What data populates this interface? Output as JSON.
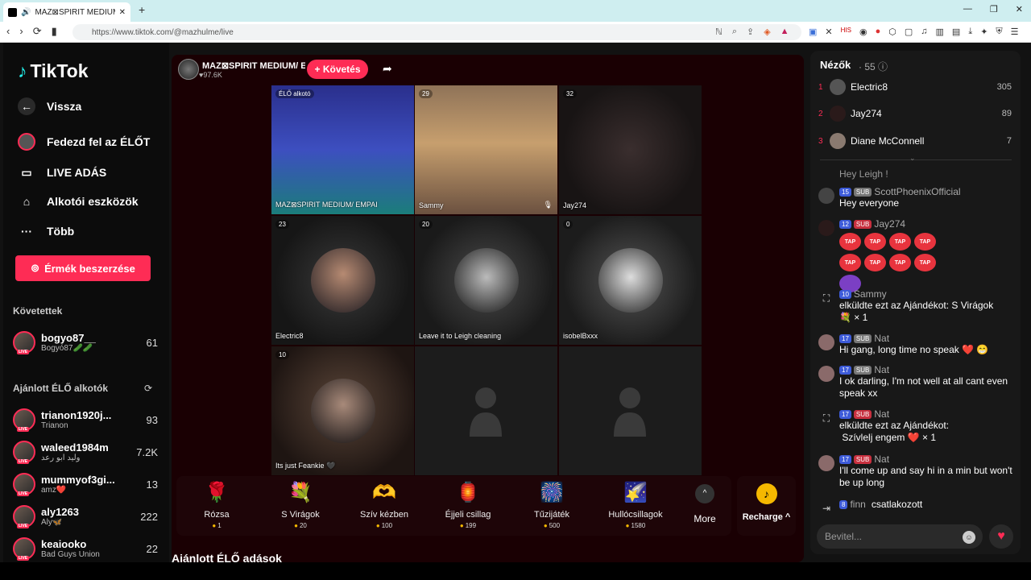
{
  "browser": {
    "tab_title": "MAZ⊠SPIRIT MEDIUM/ EMPA",
    "url": "https://www.tiktok.com/@mazhulme/live"
  },
  "nav": {
    "logo": "TikTok",
    "back": "Vissza",
    "explore": "Fedezd fel az ÉLŐT",
    "live": "LIVE ADÁS",
    "creator_tools": "Alkotói eszközök",
    "more": "Több",
    "coins_button": "Érmék beszerzése",
    "following_title": "Követettek",
    "following": [
      {
        "name": "bogyo87__",
        "sub": "Bogyó87🥒🥒",
        "count": "61"
      }
    ],
    "recommended_title": "Ajánlott ÉLŐ alkotók",
    "recommended": [
      {
        "name": "trianon1920j...",
        "sub": "Trianon",
        "count": "93"
      },
      {
        "name": "waleed1984m",
        "sub": "وليد ابو رعد",
        "count": "7.2K"
      },
      {
        "name": "mummyof3gi...",
        "sub": "amz❤️",
        "count": "13"
      },
      {
        "name": "aly1263",
        "sub": "Aly🦋",
        "count": "222"
      },
      {
        "name": "keaiooko",
        "sub": "Bad Guys Union",
        "count": "22"
      }
    ]
  },
  "stream": {
    "host_name": "MAZ⊠SPIRIT MEDIUM/ E...",
    "host_likes": "♥97.6K",
    "follow_label": "+ Követés",
    "cells": [
      {
        "count": "",
        "label": "MAZ⊠SPIRIT MEDIUM/ EMPAI",
        "tag": "ÉLŐ alkotó"
      },
      {
        "count": "29",
        "label": "Sammy"
      },
      {
        "count": "32",
        "label": "Jay274"
      },
      {
        "count": "23",
        "label": "Electric8"
      },
      {
        "count": "20",
        "label": "Leave it to Leigh cleaning"
      },
      {
        "count": "0",
        "label": "isobelBxxx"
      },
      {
        "count": "10",
        "label": "Its just Feankie 🖤"
      }
    ],
    "gifts": [
      {
        "name": "Rózsa",
        "price": "1",
        "icon": "🌹"
      },
      {
        "name": "S Virágok",
        "price": "20",
        "icon": "💐"
      },
      {
        "name": "Szív kézben",
        "price": "100",
        "icon": "🫶"
      },
      {
        "name": "Éjjeli csillag",
        "price": "199",
        "icon": "🏮"
      },
      {
        "name": "Tűzijáték",
        "price": "500",
        "icon": "🎆"
      },
      {
        "name": "Hullócsillagok",
        "price": "1580",
        "icon": "🌠"
      }
    ],
    "more_label": "More",
    "recharge_label": "Recharge ^",
    "recommended_lives": "Ajánlott ÉLŐ adások"
  },
  "panel": {
    "viewers_title": "Nézők",
    "viewers_count": "· 55",
    "ranking": [
      {
        "rank": "1",
        "name": "Electric8",
        "score": "305"
      },
      {
        "rank": "2",
        "name": "Jay274",
        "score": "89"
      },
      {
        "rank": "3",
        "name": "Diane McConnell",
        "score": "7"
      }
    ],
    "messages": {
      "m0_text": "Hey Leigh !",
      "m1_lvl": "15",
      "m1_name": "ScottPhoenixOfficial",
      "m1_text": "Hey everyone",
      "m2_lvl": "12",
      "m2_name": "Jay274",
      "m3_lvl": "10",
      "m3_name": "Sammy",
      "m3_text": "elküldte ezt az Ajándékot: S Virágok",
      "m3_qty": "× 1",
      "m4_lvl": "17",
      "m4_name": "Nat",
      "m4_text": "Hi gang, long time no speak ❤️ 😁",
      "m5_lvl": "17",
      "m5_name": "Nat",
      "m5_text": "I ok darling, I'm not well at all cant even speak xx",
      "m6_lvl": "17",
      "m6_name": "Nat",
      "m6_text": "elküldte ezt az Ajándékot:",
      "m6_gift": "Szívlelj engem",
      "m6_qty": "× 1",
      "m7_lvl": "17",
      "m7_name": "Nat",
      "m7_text": "I'll come up and say hi in a min but won't be up long",
      "m8_lvl": "8",
      "m8_name": "finn",
      "m8_text": "csatlakozott"
    },
    "sub_label": "SUB",
    "tap_label": "TAP",
    "input_placeholder": "Bevitel..."
  }
}
